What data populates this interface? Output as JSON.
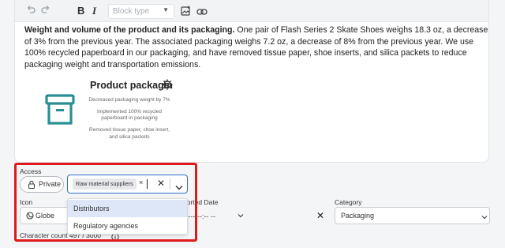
{
  "toolbar": {
    "undo_icon": "undo-icon",
    "redo_icon": "redo-icon",
    "bold_label": "B",
    "italic_label": "I",
    "block_type_placeholder": "Block type",
    "image_icon": "image-icon",
    "link_icon": "link-icon"
  },
  "content": {
    "bold_lead": "Weight and volume of the product and its packaging.",
    "paragraph": " One pair of Flash Series 2 Skate Shoes weighs 18.3 oz, a decrease of 3% from the previous year. The associated packaging weighs 7.2 oz, a decrease of 8% from the previous year. We use 100% recycled paperboard in our packaging, and have removed tissue paper, shoe inserts, and silica packets to reduce packaging weight and transportation emissions.",
    "card": {
      "title": "Product packagin",
      "lines": [
        "Decreased packaging weight by 7%",
        "Implemented 100% recycled",
        "paperboard in packaging",
        "Removed tissue paper, shoe insert,",
        "and silica packets"
      ]
    }
  },
  "form": {
    "access_label": "Access",
    "private_label": "Private",
    "selected_chip": "Raw material suppliers",
    "options": [
      "Distributors",
      "Regulatory agencies"
    ],
    "icon_label": "Icon",
    "icon_value": "Globe",
    "reported_date_label": "ported Date",
    "date_value": "/---- --:-- --",
    "category_label": "Category",
    "category_value": "Packaging",
    "char_count_label": "Character count",
    "char_count_value": "497 / 3000"
  },
  "colors": {
    "accent": "#2f6fd1",
    "highlight": "#e0191b",
    "icon_teal": "#2a8f94"
  }
}
